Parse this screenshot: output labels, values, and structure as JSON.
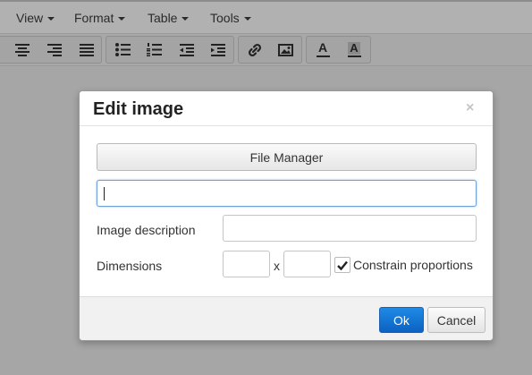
{
  "menubar": {
    "items": [
      {
        "label": "View"
      },
      {
        "label": "Format"
      },
      {
        "label": "Table"
      },
      {
        "label": "Tools"
      }
    ]
  },
  "toolbar": {
    "groups": [
      [
        "align-center-icon",
        "align-right-icon",
        "align-justify-icon"
      ],
      [
        "bullet-list-icon",
        "numbered-list-icon",
        "outdent-icon",
        "indent-icon"
      ],
      [
        "link-icon",
        "image-icon"
      ],
      [
        "text-color-icon",
        "background-color-icon"
      ]
    ],
    "text_color_glyph": "A",
    "bg_color_glyph": "A"
  },
  "dialog": {
    "title": "Edit image",
    "close_glyph": "×",
    "file_manager_label": "File Manager",
    "source_value": "",
    "description_label": "Image description",
    "description_value": "",
    "dimensions_label": "Dimensions",
    "width_value": "",
    "height_value": "",
    "dimension_separator": "x",
    "constrain_label": "Constrain proportions",
    "constrain_checked": true,
    "ok_label": "Ok",
    "cancel_label": "Cancel"
  },
  "colors": {
    "backdrop": "#a6a6a6",
    "primary_button": "#1477d6",
    "focus_border": "#6ea2d8"
  }
}
